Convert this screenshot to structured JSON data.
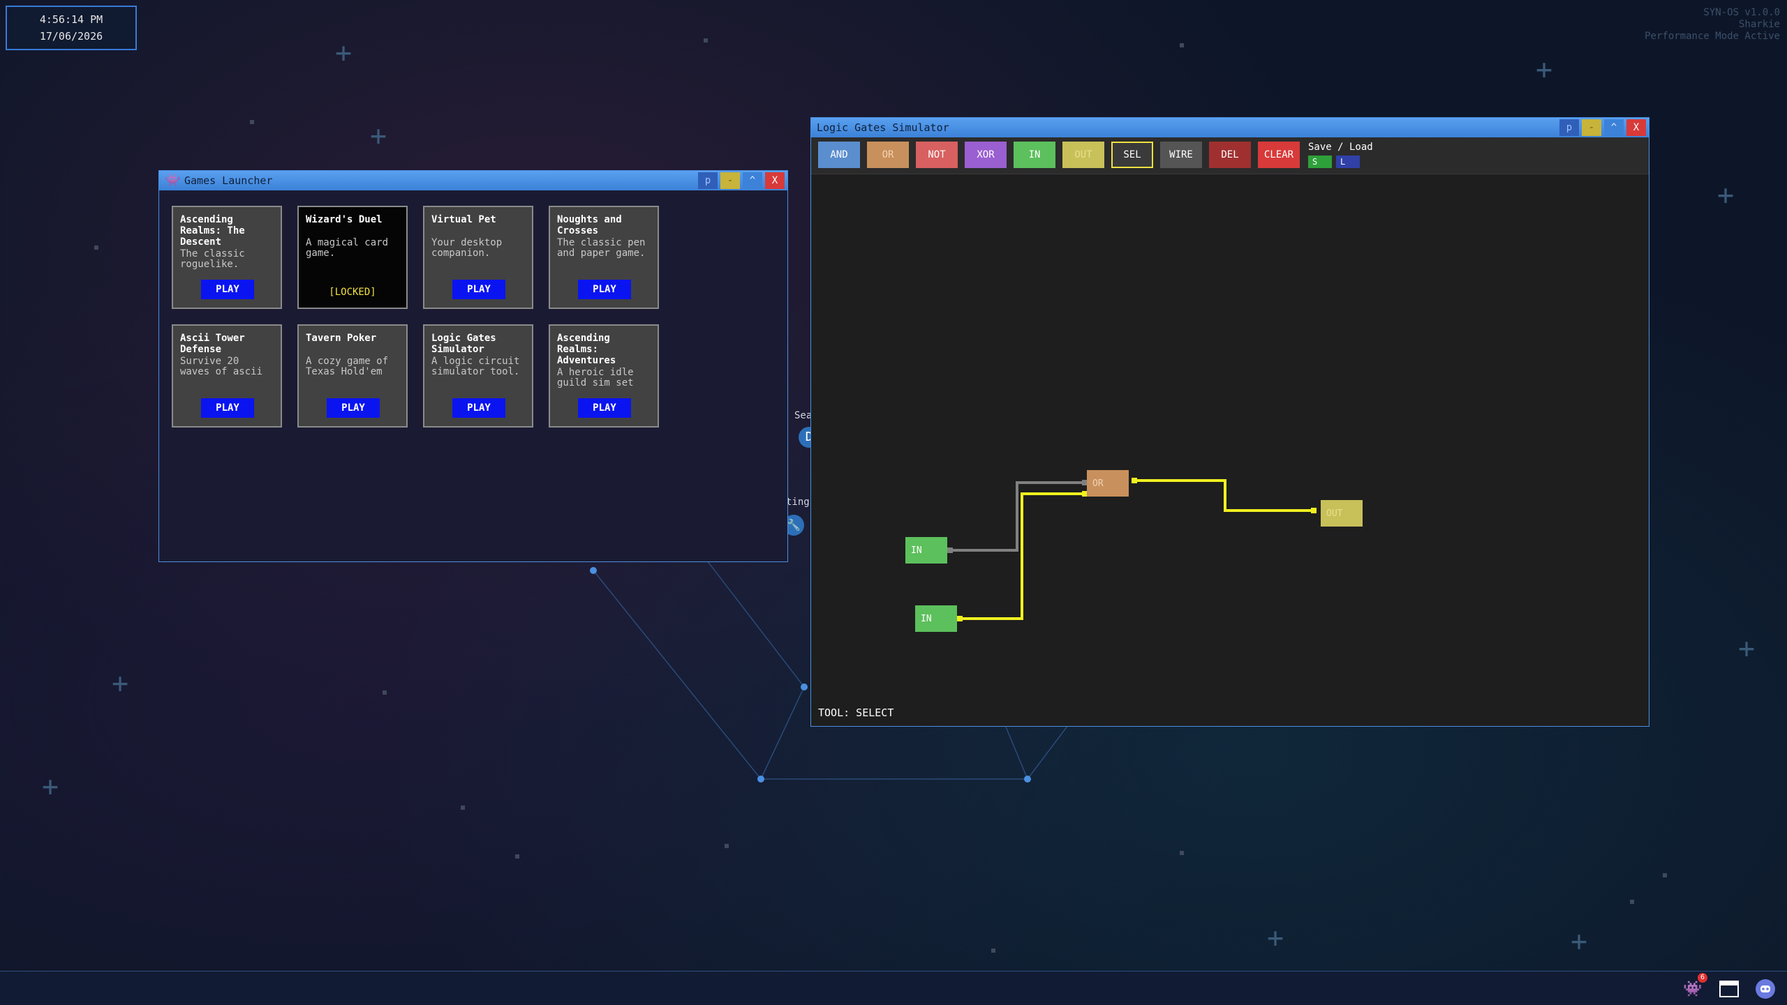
{
  "clock": {
    "time": "4:56:14 PM",
    "date": "17/06/2026"
  },
  "system": {
    "version": "SYN-OS v1.0.0",
    "user": "Sharkie",
    "mode": "Performance Mode Active"
  },
  "desktop": {
    "label_search": "Sea",
    "label_settings": "ting",
    "icon_search": "D",
    "icon_settings": "🔧"
  },
  "games_launcher": {
    "title": "Games Launcher",
    "buttons": {
      "p": "p",
      "minimize": "-",
      "maximize": "^",
      "close": "X"
    },
    "play_label": "PLAY",
    "locked_label": "[LOCKED]",
    "games": [
      {
        "title": "Ascending Realms: The Descent",
        "desc": "The classic roguelike."
      },
      {
        "title": "Wizard's Duel",
        "desc": "A magical card game."
      },
      {
        "title": "Virtual Pet",
        "desc": "Your desktop companion."
      },
      {
        "title": "Noughts and Crosses",
        "desc": "The classic pen and paper game."
      },
      {
        "title": "Ascii Tower Defense",
        "desc": "Survive 20 waves of ascii"
      },
      {
        "title": "Tavern Poker",
        "desc": "A cozy game of Texas Hold'em"
      },
      {
        "title": "Logic Gates Simulator",
        "desc": "A logic circuit simulator tool."
      },
      {
        "title": "Ascending Realms: Adventures",
        "desc": "A heroic idle guild sim set"
      }
    ]
  },
  "logic_gates": {
    "title": "Logic Gates Simulator",
    "buttons": {
      "p": "p",
      "minimize": "-",
      "maximize": "^",
      "close": "X"
    },
    "tools": {
      "and": "AND",
      "or": "OR",
      "not": "NOT",
      "xor": "XOR",
      "in": "IN",
      "out": "OUT",
      "sel": "SEL",
      "wire": "WIRE",
      "del": "DEL",
      "clear": "CLEAR"
    },
    "save_load": {
      "label": "Save / Load",
      "save": "S",
      "load": "L"
    },
    "gates": {
      "or": "OR",
      "out": "OUT",
      "in1": "IN",
      "in2": "IN"
    },
    "status": "TOOL: SELECT"
  },
  "taskbar": {
    "badge_count": "6"
  }
}
